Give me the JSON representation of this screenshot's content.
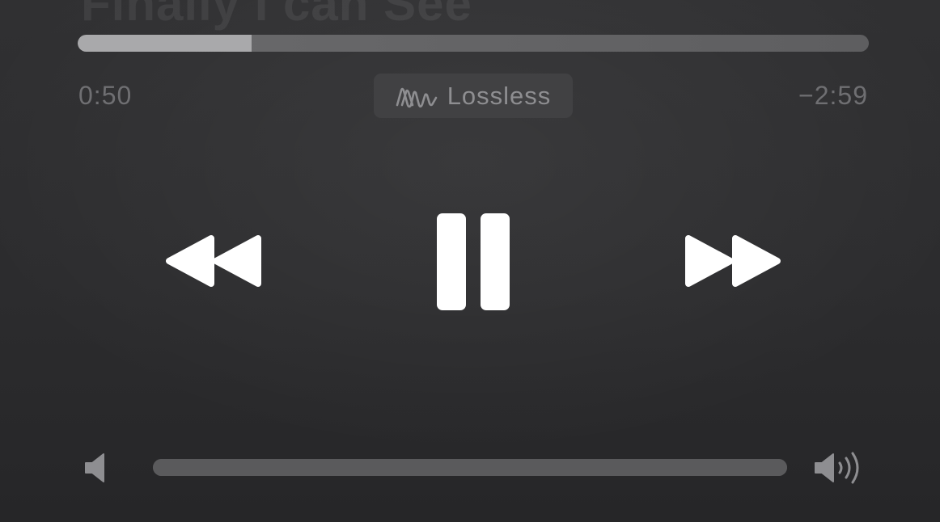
{
  "now_playing": {
    "title": "Finally I can See"
  },
  "playback": {
    "elapsed": "0:50",
    "remaining": "−2:59",
    "progress_percent": 22
  },
  "badge": {
    "icon": "lossless-waveform-icon",
    "label": "Lossless"
  },
  "controls": {
    "rewind_icon": "rewind-icon",
    "pause_icon": "pause-icon",
    "forward_icon": "fast-forward-icon"
  },
  "volume": {
    "min_icon": "speaker-low-icon",
    "max_icon": "speaker-high-icon",
    "level_percent": 100
  },
  "colors": {
    "background": "#2c2c2e",
    "progress_fill": "#a9a9ab",
    "track": "#656567",
    "control_icons": "#ffffff",
    "secondary_text": "#6f6f72"
  }
}
